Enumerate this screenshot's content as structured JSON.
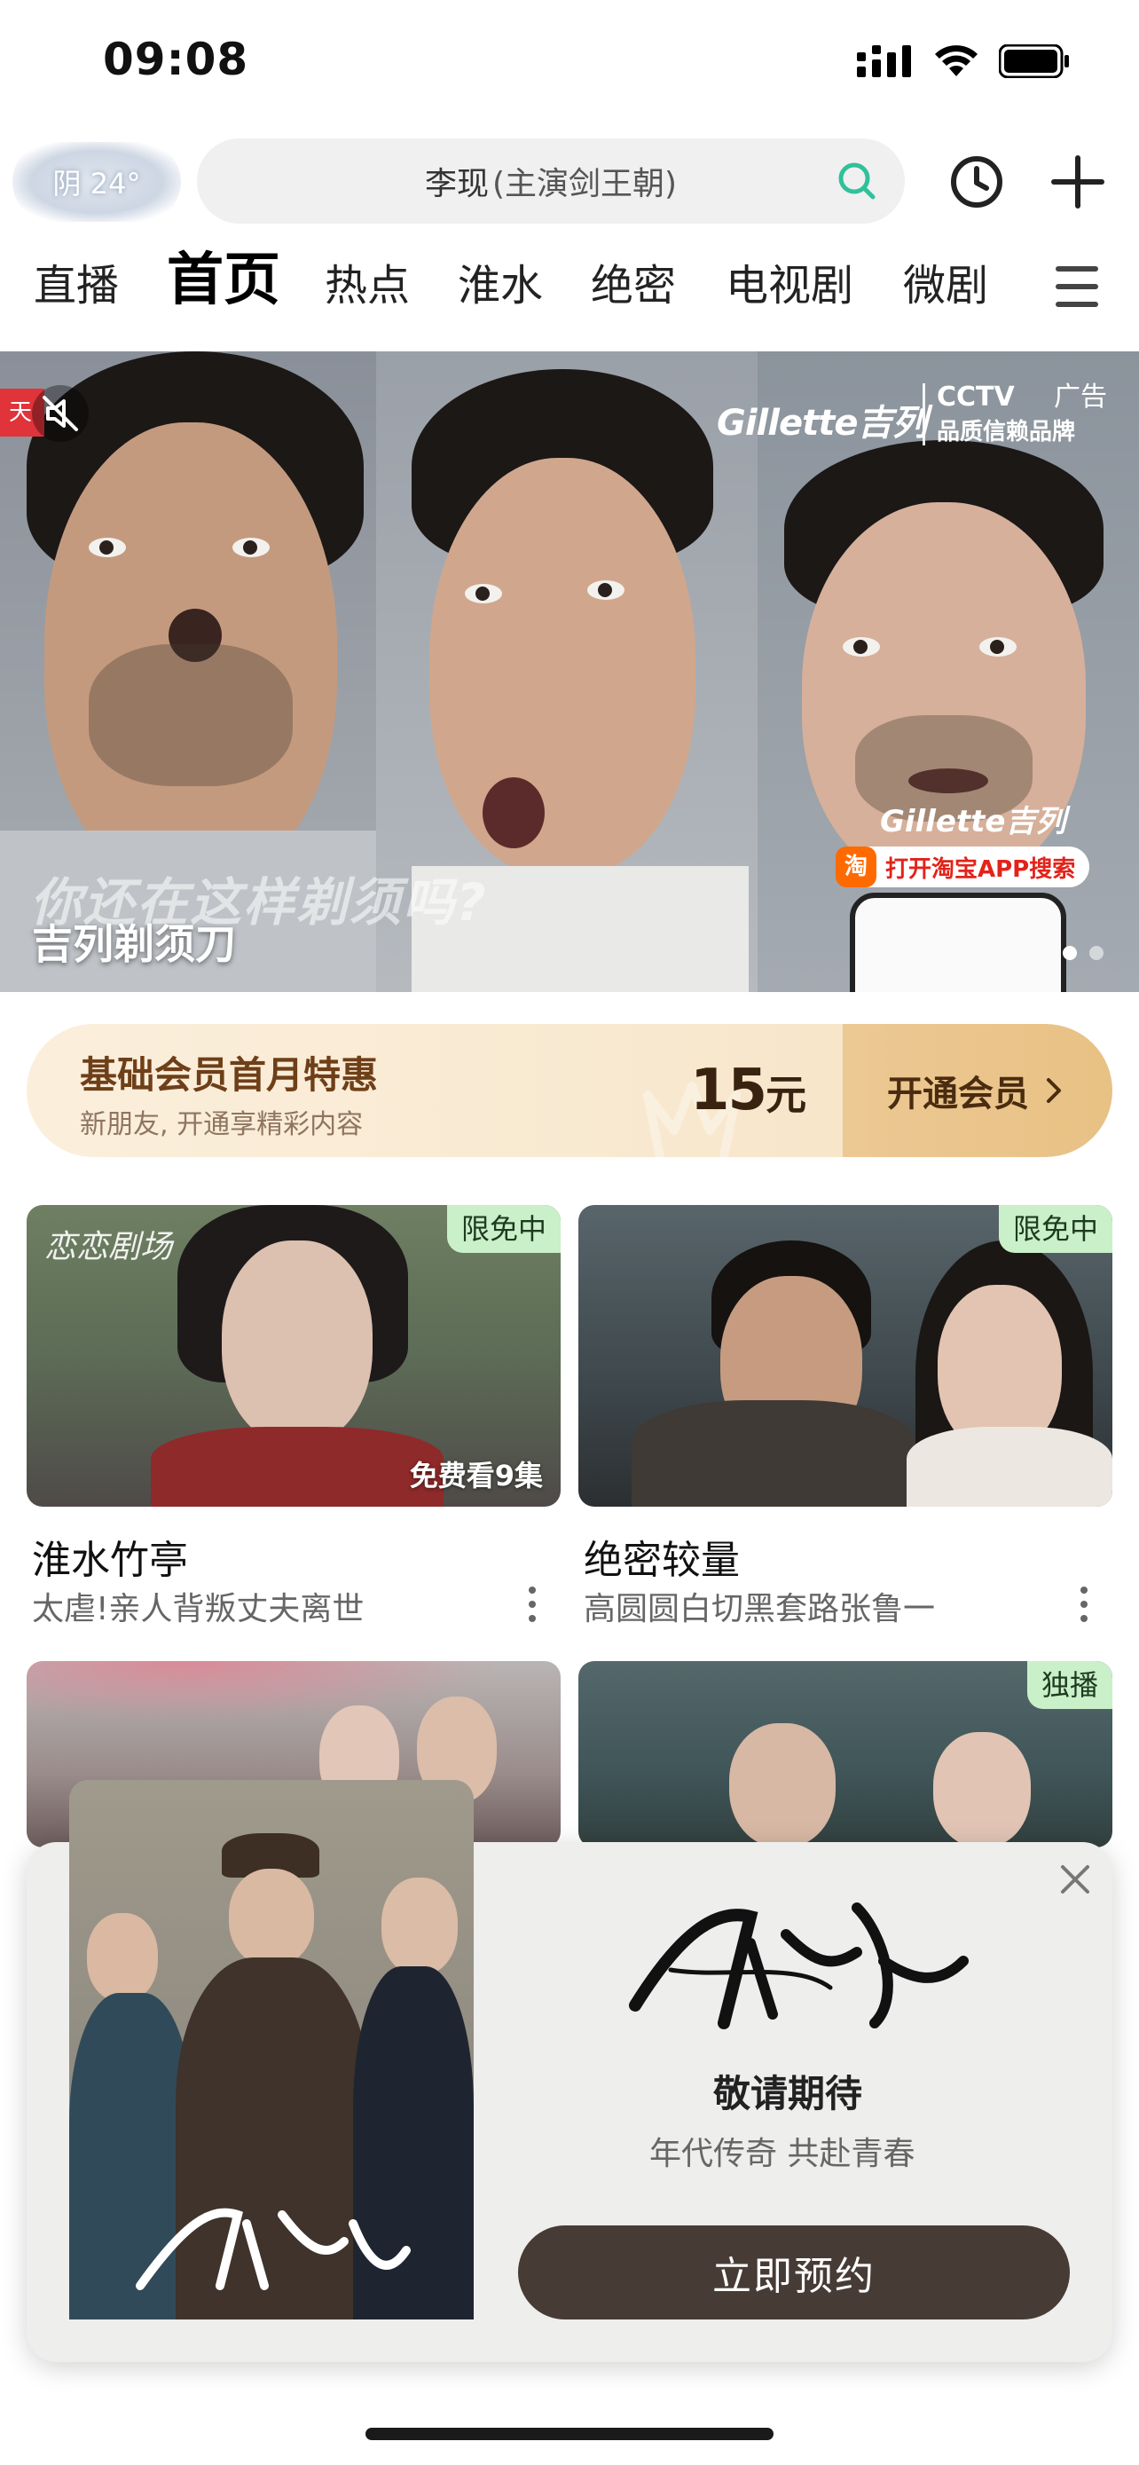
{
  "status_bar": {
    "time": "09:08"
  },
  "top_bar": {
    "weather": "阴 24°",
    "search_main": "李现",
    "search_sub": "(主演剑王朝)"
  },
  "tabs": [
    {
      "label": "直播",
      "active": false
    },
    {
      "label": "首页",
      "active": true
    },
    {
      "label": "热点",
      "active": false
    },
    {
      "label": "淮水",
      "active": false
    },
    {
      "label": "绝密",
      "active": false
    },
    {
      "label": "电视剧",
      "active": false
    },
    {
      "label": "微剧",
      "active": false
    }
  ],
  "banner": {
    "tag": "天",
    "ad_label": "广告",
    "brand": "Gillette吉列",
    "cctv": "CCTV",
    "cctv_sub": "品质信赖品牌",
    "slogan": "你还在这样剃须吗?",
    "title": "吉列剃须刀",
    "brand_small": "Gillette吉列",
    "taobao_icon": "淘",
    "taobao_text": "打开淘宝APP搜索",
    "pages": 2,
    "current_page": 1
  },
  "member": {
    "title": "基础会员首月特惠",
    "subtitle": "新朋友, 开通享精彩内容",
    "price_num": "15",
    "price_unit": "元",
    "button": "开通会员"
  },
  "cards": [
    {
      "title": "淮水竹亭",
      "desc": "太虐!亲人背叛丈夫离世",
      "badge": "限免中",
      "logo": "恋恋剧场",
      "extra": "免费看9集"
    },
    {
      "title": "绝密较量",
      "desc": "高圆圆白切黑套路张鲁一",
      "badge": "限免中"
    },
    {
      "title": "",
      "desc": "",
      "badge": ""
    },
    {
      "title": "",
      "desc": "",
      "badge": "独播"
    }
  ],
  "popup": {
    "heading": "敬请期待",
    "subtitle": "年代传奇 共赴青春",
    "cta": "立即预约"
  },
  "colors": {
    "accent_green": "#2fc19a",
    "badge_bg": "#c9f0c8",
    "member_brown": "#6e3f18",
    "cta_bg": "#473b36"
  }
}
